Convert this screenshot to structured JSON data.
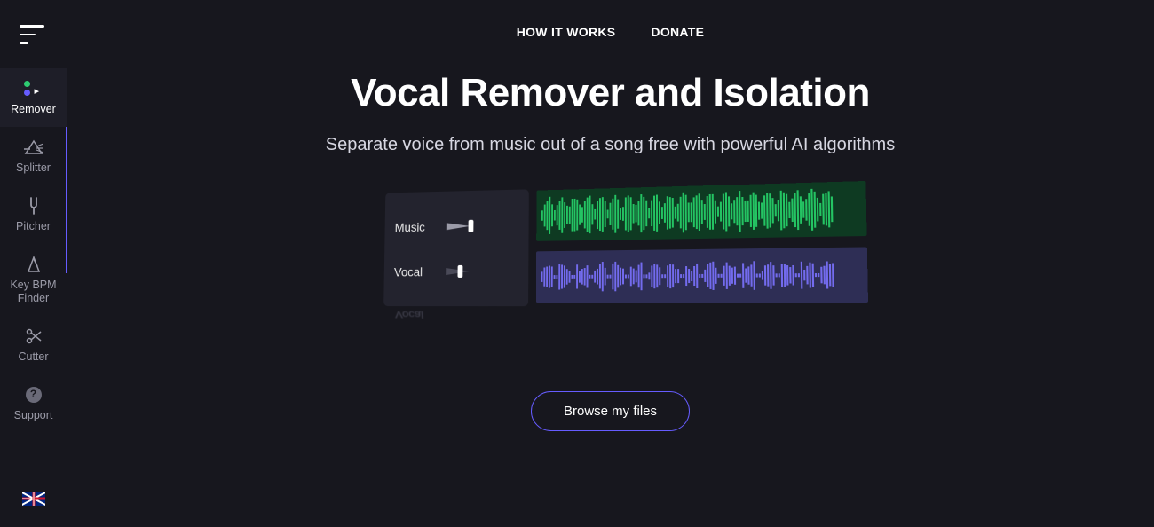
{
  "topnav": {
    "how": "HOW IT WORKS",
    "donate": "DONATE"
  },
  "hero": {
    "title": "Vocal Remover and Isolation",
    "subtitle": "Separate voice from music out of a song free with powerful AI algorithms"
  },
  "preview": {
    "track_music": "Music",
    "track_vocal": "Vocal"
  },
  "cta": {
    "browse": "Browse my files"
  },
  "sidebar": {
    "items": [
      {
        "label": "Remover"
      },
      {
        "label": "Splitter"
      },
      {
        "label": "Pitcher"
      },
      {
        "label": "Key BPM Finder"
      },
      {
        "label": "Cutter"
      },
      {
        "label": "Support"
      }
    ]
  }
}
